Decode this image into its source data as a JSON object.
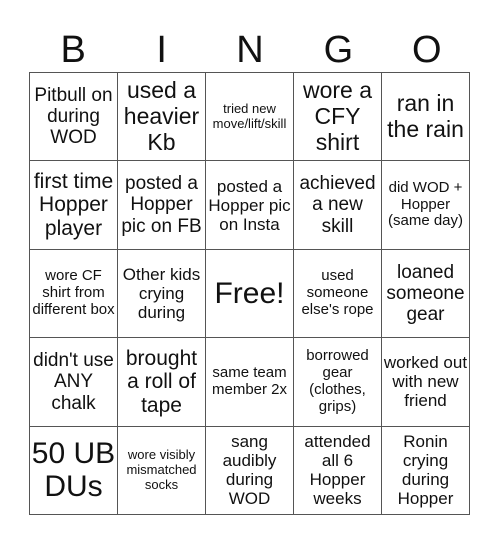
{
  "header": {
    "letters": [
      "B",
      "I",
      "N",
      "G",
      "O"
    ]
  },
  "card": {
    "rows": [
      [
        "Pitbull on during WOD",
        "used a heavier Kb",
        "tried new move/lift/skill",
        "wore a CFY shirt",
        "ran in the rain"
      ],
      [
        "first time Hopper player",
        "posted a Hopper pic on FB",
        "posted a Hopper pic on Insta",
        "achieved a new skill",
        "did WOD + Hopper (same day)"
      ],
      [
        "wore CF shirt from different box",
        "Other kids crying during",
        "Free!",
        "used someone else's rope",
        "loaned someone gear"
      ],
      [
        "didn't use ANY chalk",
        "brought a roll of tape",
        "same team member 2x",
        "borrowed gear (clothes, grips)",
        "worked out with new friend"
      ],
      [
        "50 UB DUs",
        "wore visibly mismatched socks",
        "sang audibly during WOD",
        "attended all 6 Hopper weeks",
        "Ronin crying during Hopper"
      ]
    ]
  }
}
